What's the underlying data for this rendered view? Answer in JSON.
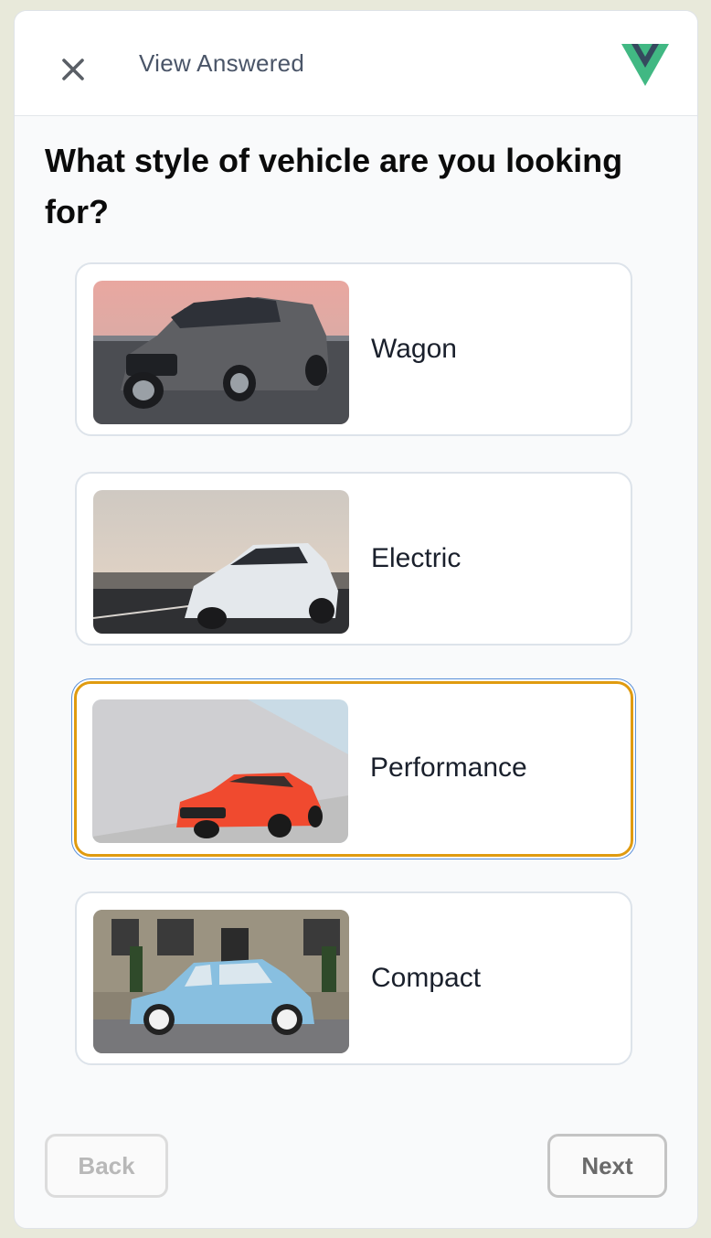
{
  "header": {
    "close_icon": "close-icon",
    "view_answered_label": "View Answered",
    "logo_icon": "vue-logo-icon",
    "logo_colors": {
      "outer": "#41b883",
      "inner": "#35495e"
    }
  },
  "question": {
    "title": "What style of vehicle are you looking for?"
  },
  "options": [
    {
      "label": "Wagon",
      "image": "gray-wagon-car",
      "selected": false
    },
    {
      "label": "Electric",
      "image": "white-electric-car",
      "selected": false
    },
    {
      "label": "Performance",
      "image": "red-performance-car",
      "selected": true
    },
    {
      "label": "Compact",
      "image": "blue-compact-car",
      "selected": false
    }
  ],
  "footer": {
    "back_label": "Back",
    "back_enabled": false,
    "next_label": "Next"
  },
  "colors": {
    "selected_border": "#e09b10",
    "focus_ring": "#5a8fd8",
    "card_border": "#dde3ea"
  }
}
